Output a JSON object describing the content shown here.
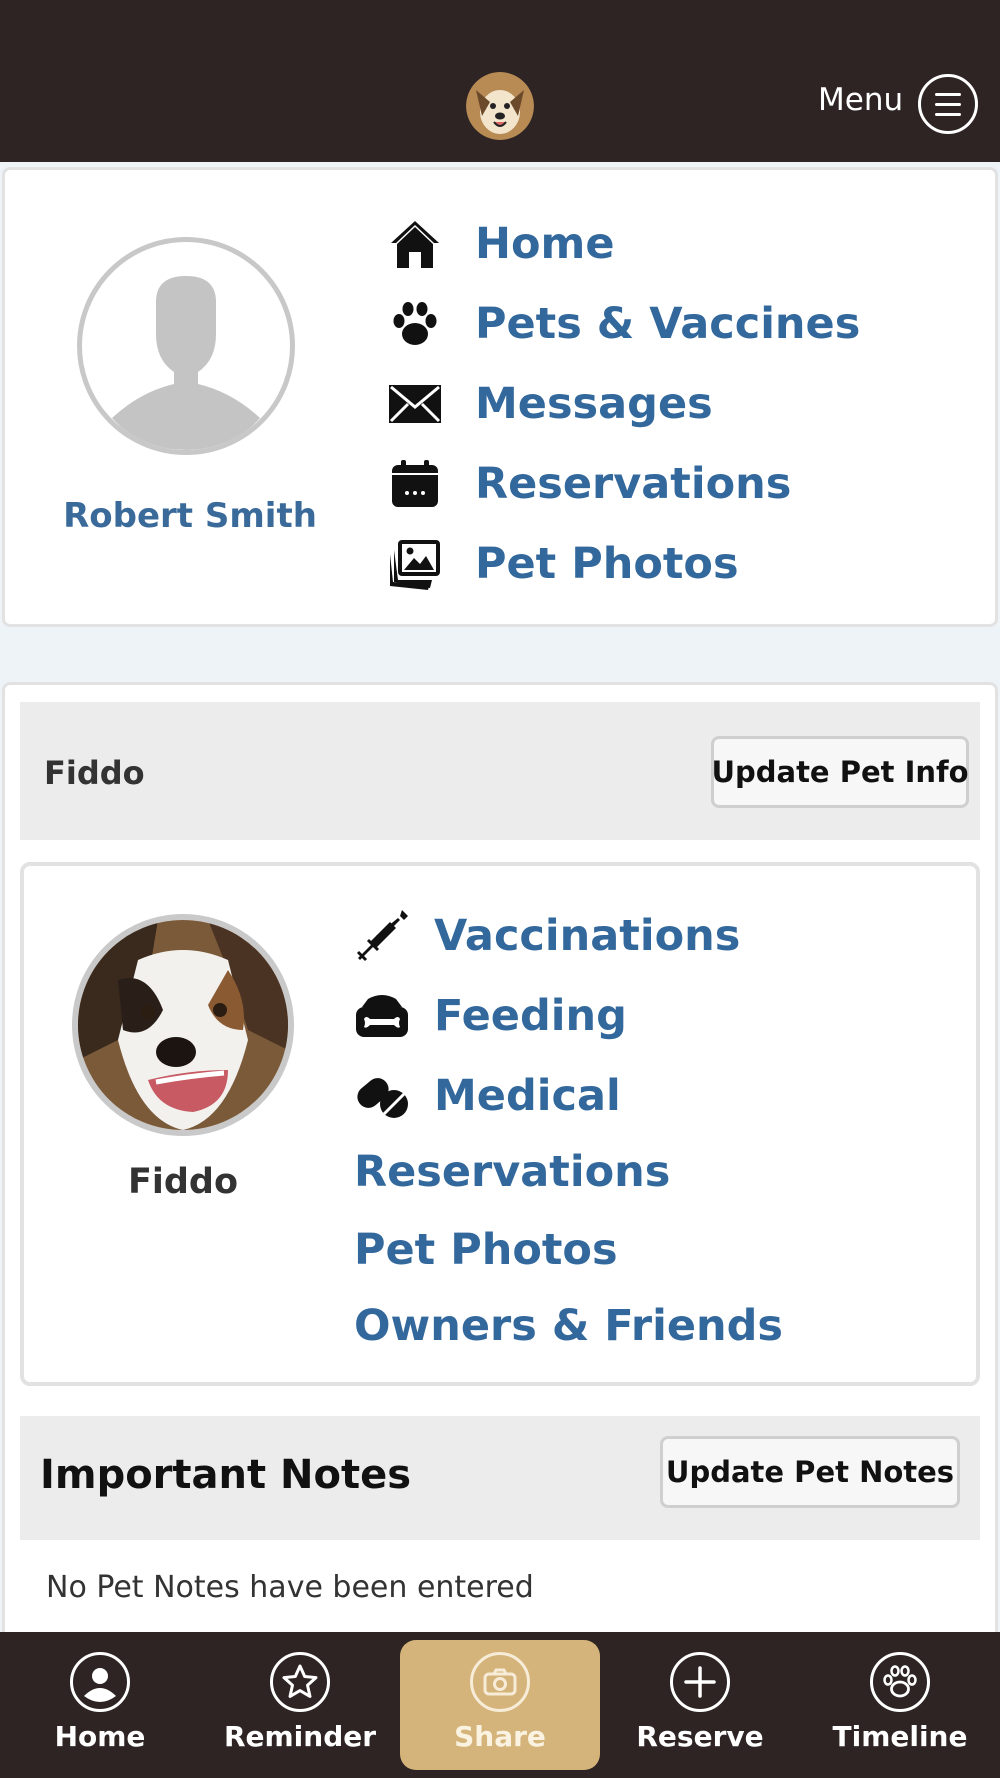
{
  "header": {
    "logo_icon": "dog-logo-icon",
    "menu_label": "Menu",
    "menu_icon": "hamburger-icon"
  },
  "profile": {
    "name": "Robert Smith",
    "avatar_icon": "default-user-avatar"
  },
  "main_nav": [
    {
      "label": "Home",
      "icon": "home-icon"
    },
    {
      "label": "Pets & Vaccines",
      "icon": "paw-icon"
    },
    {
      "label": "Messages",
      "icon": "envelope-icon"
    },
    {
      "label": "Reservations",
      "icon": "calendar-icon"
    },
    {
      "label": "Pet Photos",
      "icon": "photos-icon"
    }
  ],
  "pet": {
    "header_name": "Fiddo",
    "update_info_label": "Update Pet Info",
    "name": "Fiddo",
    "links": [
      {
        "label": "Vaccinations",
        "icon": "syringe-icon"
      },
      {
        "label": "Feeding",
        "icon": "food-bowl-icon"
      },
      {
        "label": "Medical",
        "icon": "pills-icon"
      },
      {
        "label": "Reservations",
        "icon": ""
      },
      {
        "label": "Pet Photos",
        "icon": ""
      },
      {
        "label": "Owners & Friends",
        "icon": ""
      }
    ]
  },
  "notes": {
    "title": "Important Notes",
    "update_label": "Update Pet Notes",
    "empty_text": "No Pet Notes have been entered"
  },
  "tabbar": [
    {
      "label": "Home",
      "icon": "user-circle-icon",
      "active": false
    },
    {
      "label": "Reminder",
      "icon": "star-icon",
      "active": false
    },
    {
      "label": "Share",
      "icon": "camera-icon",
      "active": true
    },
    {
      "label": "Reserve",
      "icon": "plus-icon",
      "active": false
    },
    {
      "label": "Timeline",
      "icon": "paw-icon",
      "active": false
    }
  ],
  "colors": {
    "topbar": "#2e2424",
    "link": "#33689c",
    "active_tab": "#d4b47a"
  }
}
